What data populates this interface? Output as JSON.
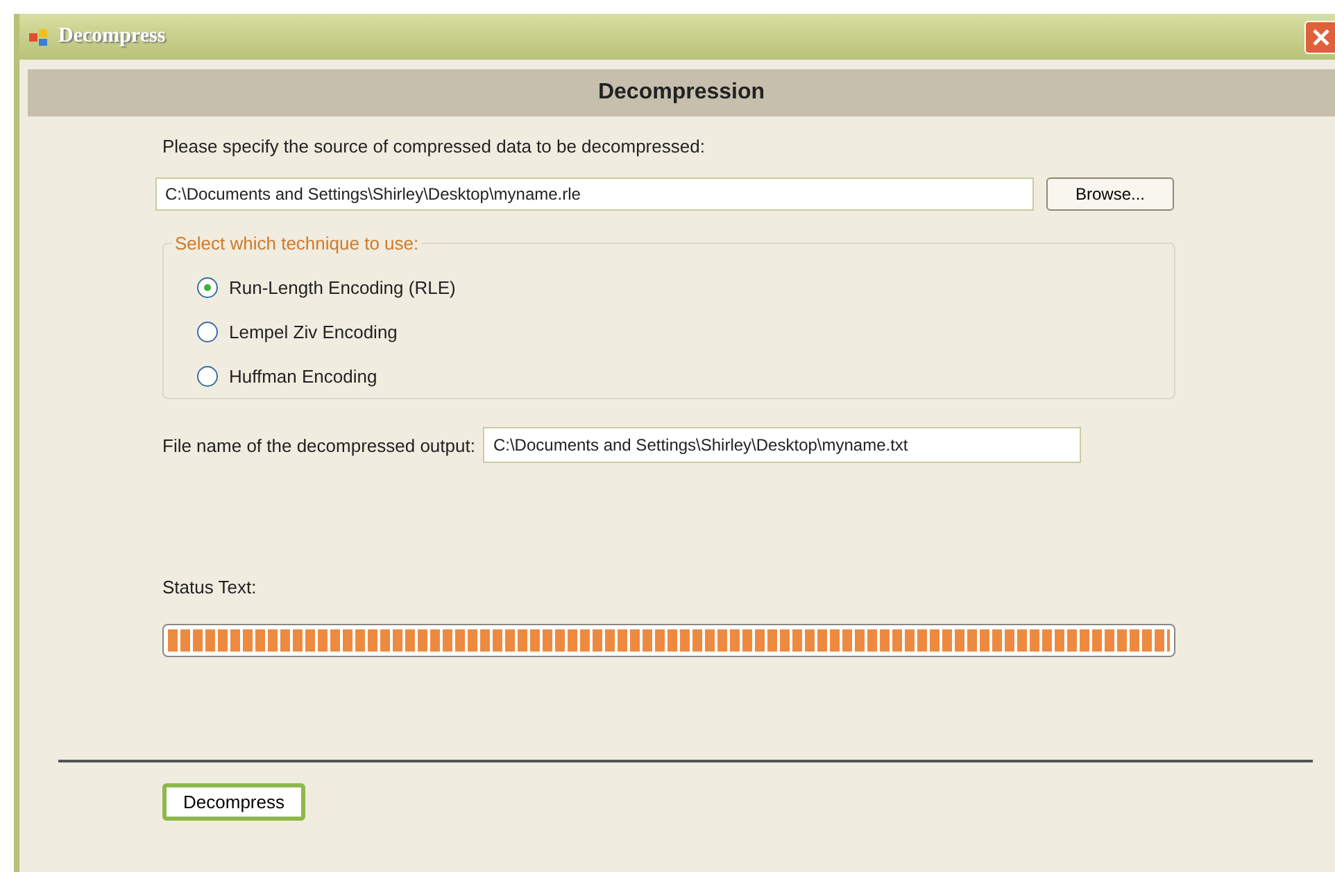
{
  "window": {
    "title": "Decompress"
  },
  "header": "Decompression",
  "source": {
    "label": "Please specify the source of compressed data to be decompressed:",
    "value": "C:\\Documents and Settings\\Shirley\\Desktop\\myname.rle",
    "browse": "Browse..."
  },
  "technique": {
    "legend": "Select which technique to use:",
    "options": [
      {
        "label": "Run-Length Encoding (RLE)",
        "selected": true
      },
      {
        "label": "Lempel Ziv Encoding",
        "selected": false
      },
      {
        "label": "Huffman Encoding",
        "selected": false
      }
    ]
  },
  "output": {
    "label": "File name of the decompressed output:",
    "value": "C:\\Documents and Settings\\Shirley\\Desktop\\myname.txt"
  },
  "status": {
    "label": "Status Text:",
    "level": 1
  },
  "buttons": [
    "Decompress"
  ]
}
